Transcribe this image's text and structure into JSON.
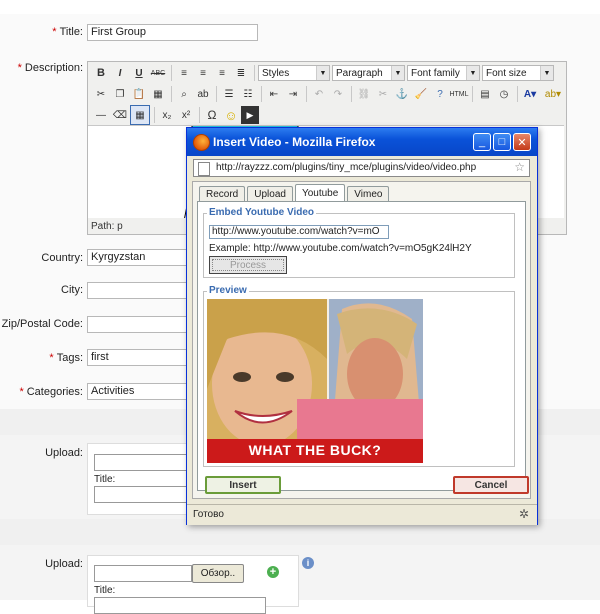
{
  "form": {
    "title_label": "Title:",
    "title_value": "First Group",
    "description_label": "Description:",
    "path_text": "Path: p",
    "country_label": "Country:",
    "country_value": "Kyrgyzstan",
    "city_label": "City:",
    "zip_label": "Zip/Postal Code:",
    "tags_label": "Tags:",
    "tags_value": "first",
    "categories_label": "Categories:",
    "categories_value": "Activities",
    "upload_label": "Upload:",
    "upload_title_label": "Title:",
    "browse_label": "Обзор..",
    "required_mark": "*"
  },
  "toolbar": {
    "bold": "B",
    "italic": "I",
    "underline": "U",
    "strike": "ABC",
    "styles": "Styles",
    "paragraph": "Paragraph",
    "font_family": "Font family",
    "font_size": "Font size",
    "subscript": "x₂",
    "superscript": "x²",
    "omega": "Ω",
    "html": "HTML"
  },
  "popup": {
    "window_title": "Insert Video - Mozilla Firefox",
    "url": "http://rayzzz.com/plugins/tiny_mce/plugins/video/video.php",
    "tabs": [
      {
        "label": "Record"
      },
      {
        "label": "Upload"
      },
      {
        "label": "Youtube",
        "active": true
      },
      {
        "label": "Vimeo"
      }
    ],
    "embed_legend": "Embed Youtube Video",
    "youtube_input_value": "http://www.youtube.com/watch?v=mO",
    "example_text": "Example: http://www.youtube.com/watch?v=mO5gK24lH2Y",
    "process_label": "Process",
    "preview_legend": "Preview",
    "preview_caption": "WHAT THE BUCK?",
    "insert_label": "Insert",
    "cancel_label": "Cancel",
    "status_text": "Готово"
  },
  "colors": {
    "titlebar": "#0a52d8",
    "required": "#cc0000",
    "legend": "#3a6bb0",
    "preview_banner": "#cc1a1a"
  }
}
